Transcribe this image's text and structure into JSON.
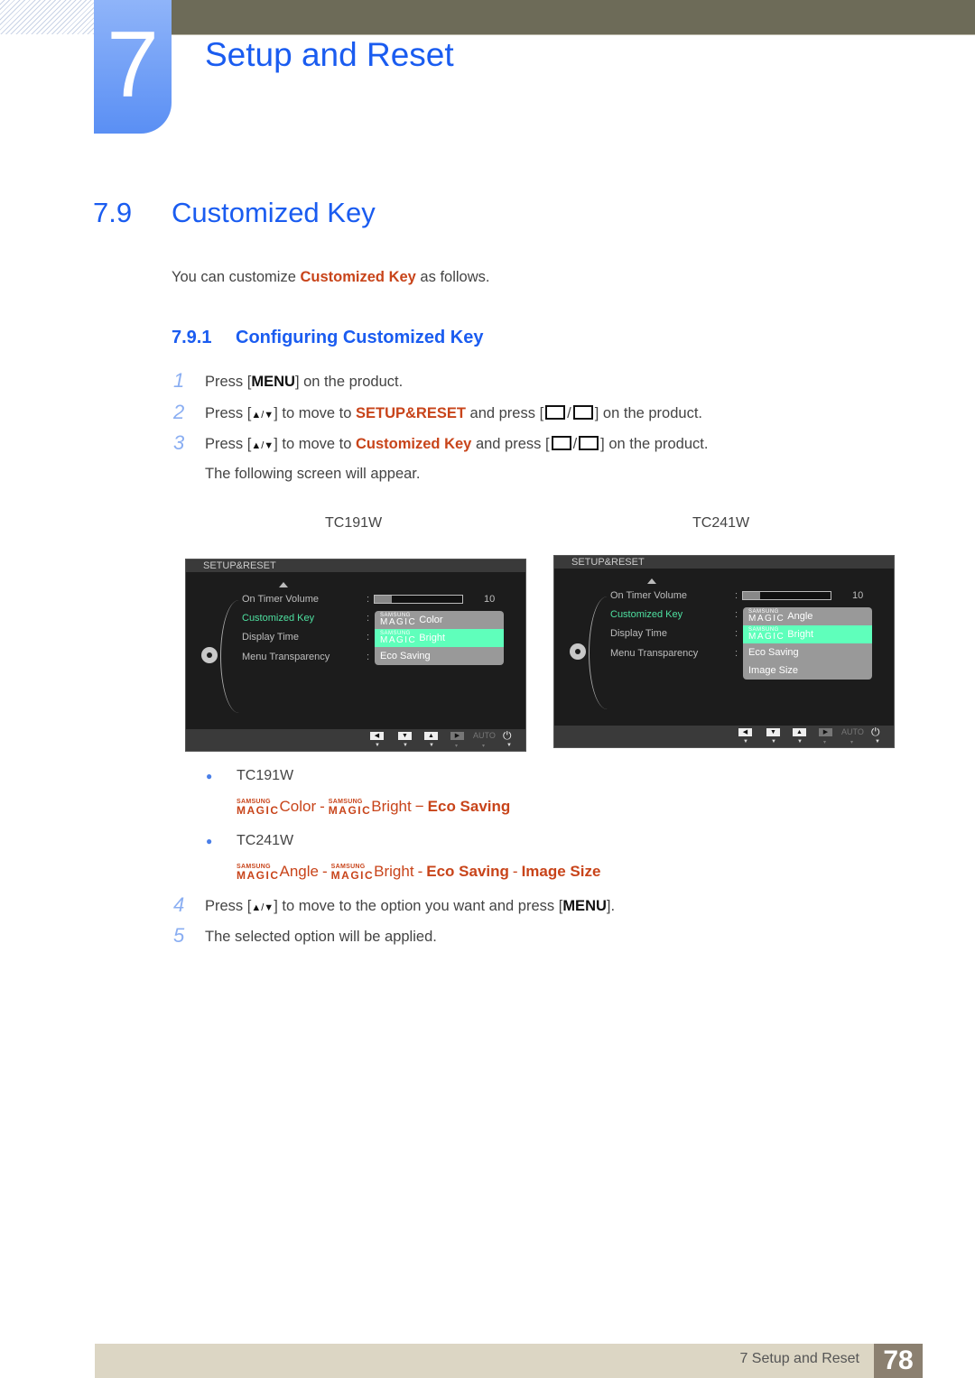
{
  "chapter": {
    "number": "7",
    "title": "Setup and Reset"
  },
  "section": {
    "number": "7.9",
    "title": "Customized Key"
  },
  "intro": {
    "before": "You can customize ",
    "highlight": "Customized Key",
    "after": " as follows."
  },
  "subsection": {
    "number": "7.9.1",
    "title": "Configuring Customized Key"
  },
  "steps": [
    {
      "n": "1",
      "parts": [
        "Press [",
        "MENU",
        "] on the product."
      ]
    },
    {
      "n": "2",
      "parts": [
        "Press [",
        "▲/▼",
        "] to move to ",
        "SETUP&RESET",
        " and press [",
        "",
        "] on the product."
      ]
    },
    {
      "n": "3",
      "parts": [
        "Press [",
        "▲/▼",
        "] to move to ",
        "Customized Key",
        " and press [",
        "",
        "] on the product."
      ]
    },
    {
      "n": "",
      "text": "The following screen will appear."
    },
    {
      "n": "4",
      "parts": [
        "Press [",
        "▲/▼",
        "] to move to the option you want and press [",
        "MENU",
        "]."
      ]
    },
    {
      "n": "5",
      "text": "The selected option will be applied."
    }
  ],
  "screens": [
    {
      "model": "TC191W",
      "header": "SETUP&RESET",
      "items": [
        "On Timer  Volume",
        "Customized Key",
        "Display Time",
        "Menu Transparency"
      ],
      "volume_value": "10",
      "volume_fraction": 0.2,
      "options": [
        {
          "brand_small": "SAMSUNG",
          "brand_big": "MAGIC",
          "label": "Color",
          "selected": false
        },
        {
          "brand_small": "SAMSUNG",
          "brand_big": "MAGIC",
          "label": "Bright",
          "selected": true
        },
        {
          "brand_small": "",
          "brand_big": "",
          "label": "Eco Saving",
          "selected": false
        }
      ],
      "footer_auto": "AUTO"
    },
    {
      "model": "TC241W",
      "header": "SETUP&RESET",
      "items": [
        "On Timer  Volume",
        "Customized Key",
        "Display Time",
        "Menu Transparency"
      ],
      "volume_value": "10",
      "volume_fraction": 0.2,
      "options": [
        {
          "brand_small": "SAMSUNG",
          "brand_big": "MAGIC",
          "label": "Angle",
          "selected": false
        },
        {
          "brand_small": "SAMSUNG",
          "brand_big": "MAGIC",
          "label": "Bright",
          "selected": true
        },
        {
          "brand_small": "",
          "brand_big": "",
          "label": "Eco Saving",
          "selected": false
        },
        {
          "brand_small": "",
          "brand_big": "",
          "label": "Image Size",
          "selected": false
        }
      ],
      "footer_auto": "AUTO"
    }
  ],
  "bullets": [
    {
      "model": "TC191W",
      "brand_small": "SAMSUNG",
      "brand_big": "MAGIC",
      "line": [
        "Color",
        " - ",
        "Bright",
        " − ",
        "Eco Saving"
      ]
    },
    {
      "model": "TC241W",
      "brand_small": "SAMSUNG",
      "brand_big": "MAGIC",
      "line": [
        "Angle",
        " - ",
        "Bright",
        " - ",
        "Eco Saving",
        " - ",
        "Image Size"
      ]
    }
  ],
  "footer": {
    "text": "7 Setup and Reset",
    "page": "78"
  },
  "colors": {
    "heading_blue": "#1a5cf0",
    "highlight_orange": "#c8441a",
    "osd_active_green": "#4ee0a0",
    "osd_selected_bg": "#5fffbb"
  }
}
